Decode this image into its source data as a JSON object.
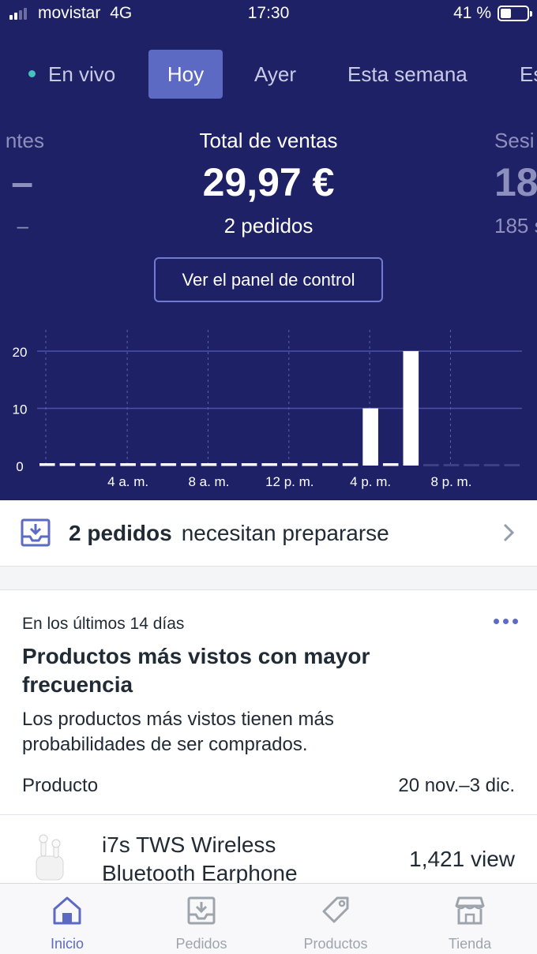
{
  "status_bar": {
    "carrier": "movistar",
    "network": "4G",
    "time": "17:30",
    "battery": "41 %",
    "battery_level": 0.41
  },
  "period_tabs": [
    {
      "label": "En vivo",
      "live": true
    },
    {
      "label": "Hoy",
      "active": true
    },
    {
      "label": "Ayer"
    },
    {
      "label": "Esta semana"
    },
    {
      "label": "Es"
    }
  ],
  "metrics": {
    "left": {
      "label": "ntes",
      "value": "–",
      "sub": "–"
    },
    "center": {
      "label": "Total de ventas",
      "value": "29,97 €",
      "sub": "2 pedidos"
    },
    "right": {
      "label": "Sesi",
      "value": "18",
      "sub": "185 s"
    }
  },
  "dashboard_button": "Ver el panel de control",
  "chart_data": {
    "type": "bar",
    "x": [
      "12 a. m.",
      "1 a. m.",
      "2 a. m.",
      "3 a. m.",
      "4 a. m.",
      "5 a. m.",
      "6 a. m.",
      "7 a. m.",
      "8 a. m.",
      "9 a. m.",
      "10 a. m.",
      "11 a. m.",
      "12 p. m.",
      "1 p. m.",
      "2 p. m.",
      "3 p. m.",
      "4 p. m.",
      "5 p. m.",
      "6 p. m.",
      "7 p. m.",
      "8 p. m.",
      "9 p. m.",
      "10 p. m.",
      "11 p. m."
    ],
    "values": [
      0,
      0,
      0,
      0,
      0,
      0,
      0,
      0,
      0,
      0,
      0,
      0,
      0,
      0,
      0,
      0,
      10,
      0,
      20,
      null,
      null,
      null,
      null,
      null
    ],
    "tick_labels": [
      "4 a. m.",
      "8 a. m.",
      "12 p. m.",
      "4 p. m.",
      "8 p. m."
    ],
    "tick_indices": [
      4,
      8,
      12,
      16,
      20
    ],
    "y_ticks": [
      "0",
      "10",
      "20"
    ],
    "ylim": [
      0,
      20
    ],
    "grid": true,
    "colors": {
      "bar": "#ffffff",
      "future": "#3c4185",
      "grid": "#4a52a8"
    }
  },
  "orders_alert": {
    "count_label": "2 pedidos",
    "text": "necesitan prepararse"
  },
  "products_card": {
    "caption": "En los últimos 14 días",
    "title": "Productos más vistos con mayor frecuencia",
    "description": "Los productos más vistos tienen más probabilidades de ser comprados.",
    "column_product": "Producto",
    "column_range": "20 nov.–3 dic.",
    "products": [
      {
        "name": "i7s TWS Wireless Bluetooth Earphone",
        "views": "1,421 view"
      }
    ]
  },
  "bottom_nav": [
    {
      "label": "Inicio",
      "icon": "home-icon",
      "active": true
    },
    {
      "label": "Pedidos",
      "icon": "orders-icon"
    },
    {
      "label": "Productos",
      "icon": "tag-icon"
    },
    {
      "label": "Tienda",
      "icon": "store-icon"
    }
  ],
  "colors": {
    "header_bg": "#1e2166",
    "accent": "#5c6ac4",
    "live": "#47c1bf"
  }
}
